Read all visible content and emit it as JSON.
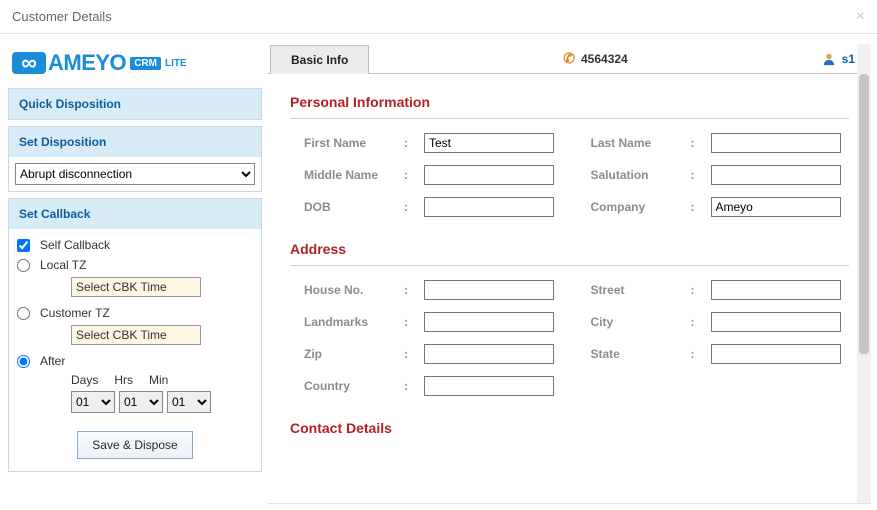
{
  "window": {
    "title": "Customer Details"
  },
  "logo": {
    "brand": "AMEYO",
    "crm": "CRM",
    "lite": "LITE"
  },
  "sidebar": {
    "quick_disposition": {
      "title": "Quick Disposition"
    },
    "set_disposition": {
      "title": "Set Disposition",
      "selected": "Abrupt disconnection"
    },
    "set_callback": {
      "title": "Set Callback",
      "self_callback": {
        "label": "Self Callback",
        "checked": true
      },
      "local_tz": {
        "label": "Local TZ",
        "checked": false,
        "cbk_placeholder": "Select CBK Time"
      },
      "customer_tz": {
        "label": "Customer TZ",
        "checked": false,
        "cbk_placeholder": "Select CBK Time"
      },
      "after": {
        "label": "After",
        "checked": true,
        "days_label": "Days",
        "hrs_label": "Hrs",
        "min_label": "Min",
        "days": "01",
        "hrs": "01",
        "min": "01"
      },
      "save_label": "Save & Dispose"
    }
  },
  "header": {
    "tab_label": "Basic Info",
    "phone": "4564324",
    "user": "s1"
  },
  "personal": {
    "title": "Personal Information",
    "first_name_label": "First Name",
    "first_name": "Test",
    "last_name_label": "Last Name",
    "last_name": "",
    "middle_name_label": "Middle Name",
    "middle_name": "",
    "salutation_label": "Salutation",
    "salutation": "",
    "dob_label": "DOB",
    "dob": "",
    "company_label": "Company",
    "company": "Ameyo"
  },
  "address": {
    "title": "Address",
    "house_label": "House No.",
    "house": "",
    "street_label": "Street",
    "street": "",
    "landmarks_label": "Landmarks",
    "landmarks": "",
    "city_label": "City",
    "city": "",
    "zip_label": "Zip",
    "zip": "",
    "state_label": "State",
    "state": "",
    "country_label": "Country",
    "country": ""
  },
  "contact": {
    "title": "Contact Details"
  }
}
